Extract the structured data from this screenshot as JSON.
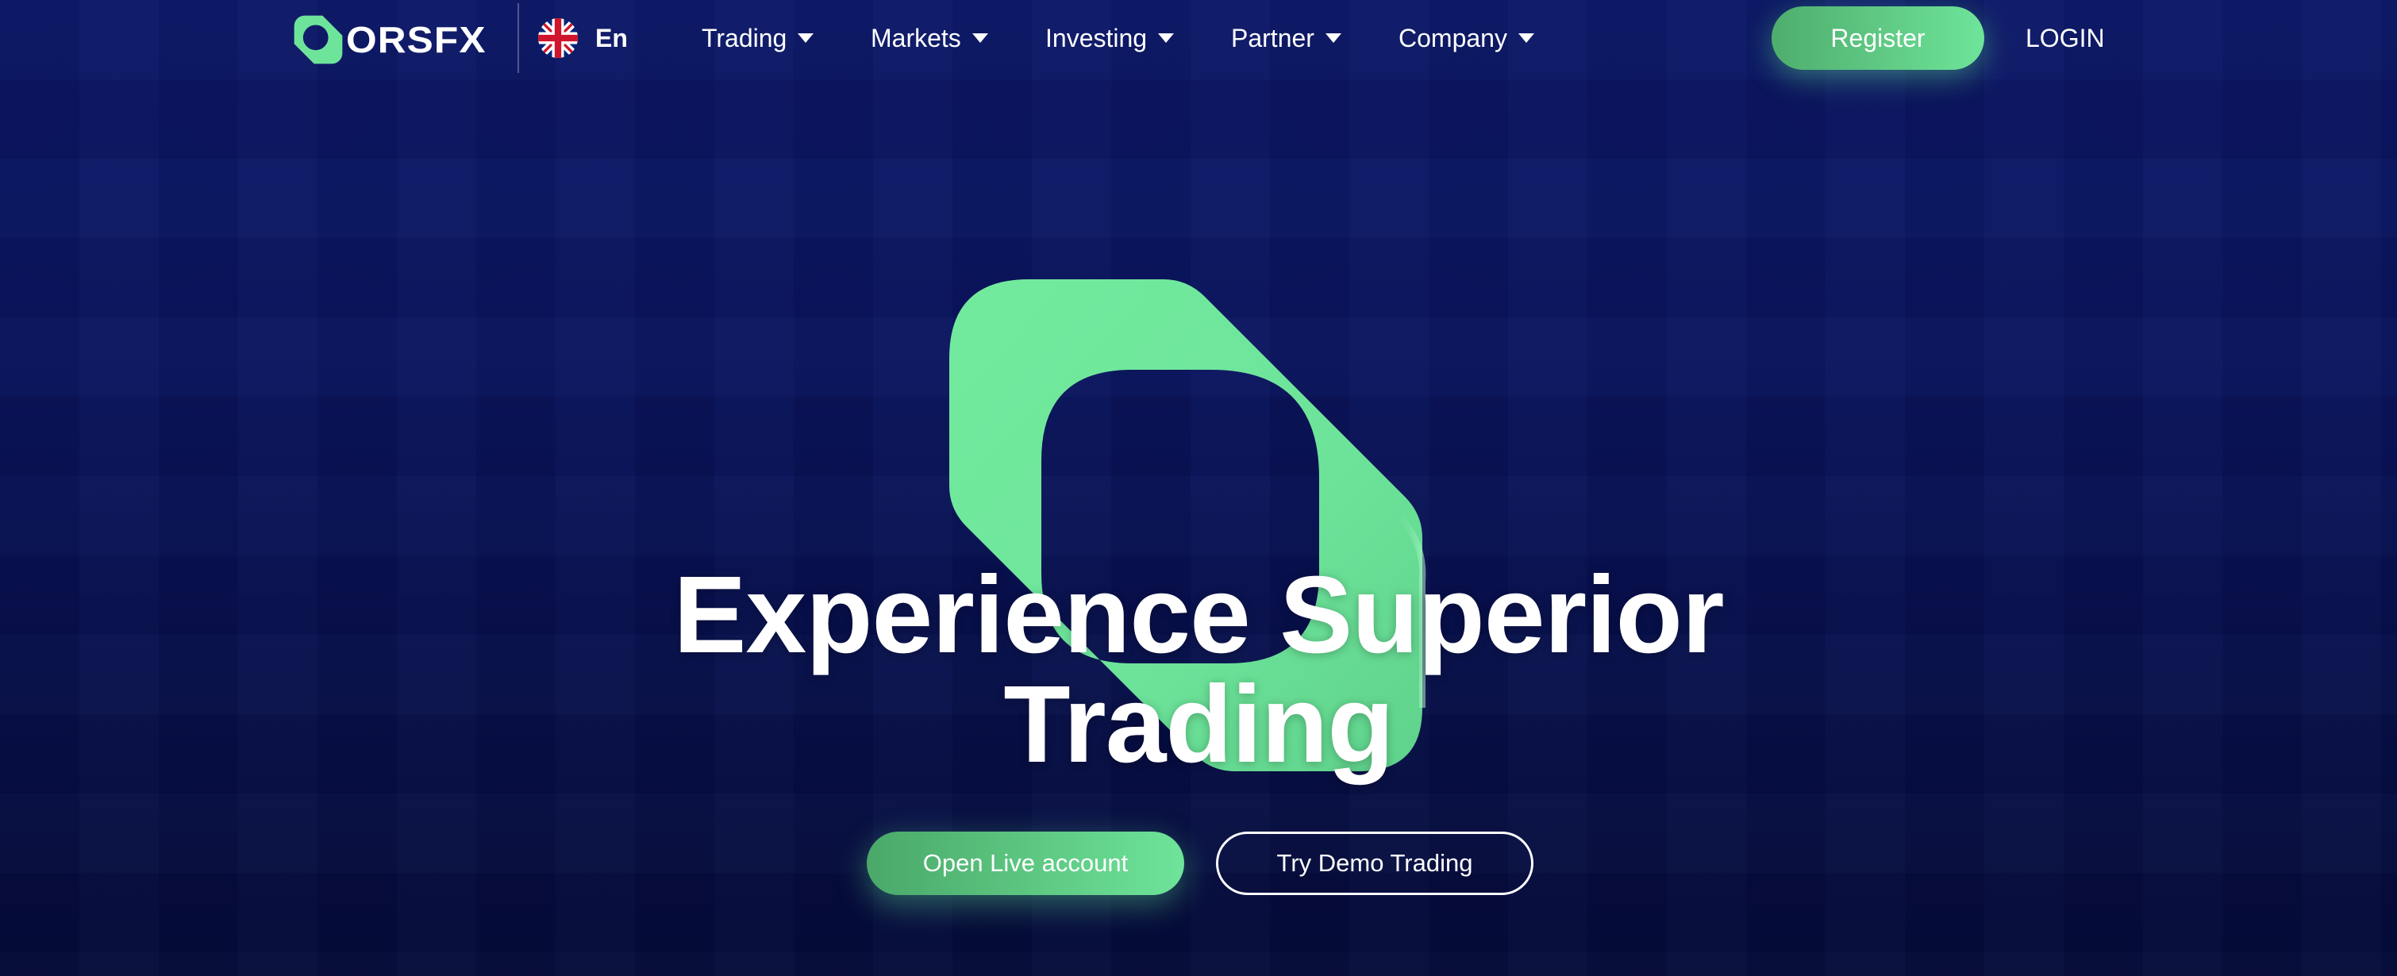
{
  "brand": {
    "name": "ORSFX",
    "logo_icon": "orsfx-logo-mark",
    "accent_color": "#6ee49a",
    "accent_dark": "#4fad6d",
    "background_color": "#0a1560"
  },
  "language": {
    "flag_icon": "uk-flag-icon",
    "label": "En"
  },
  "nav": {
    "items": [
      {
        "label": "Trading",
        "icon": "chevron-down-icon"
      },
      {
        "label": "Markets",
        "icon": "chevron-down-icon"
      },
      {
        "label": "Investing",
        "icon": "chevron-down-icon"
      },
      {
        "label": "Partner",
        "icon": "chevron-down-icon"
      },
      {
        "label": "Company",
        "icon": "chevron-down-icon"
      }
    ],
    "register_label": "Register",
    "login_label": "LOGIN"
  },
  "hero": {
    "title_line1": "Experience Superior",
    "title_line2": "Trading",
    "graphic_icon": "orsfx-logo-mark",
    "primary_cta": "Open Live account",
    "secondary_cta": "Try Demo Trading"
  }
}
